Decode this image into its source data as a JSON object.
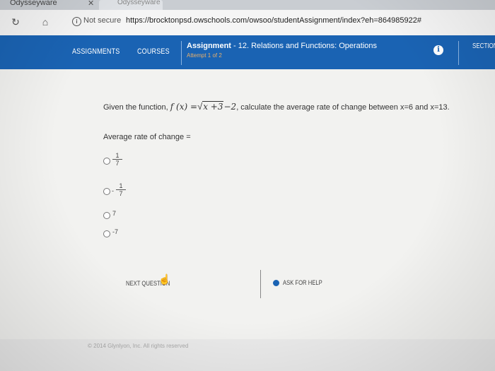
{
  "browser": {
    "tab_title": "Odysseyware",
    "tab_close": "✕",
    "tab2_title": "Odysseyware",
    "security_label": "Not secure",
    "url": "https://brocktonpsd.owschools.com/owsoo/studentAssignment/index?eh=864985922#"
  },
  "nav": {
    "assignments": "ASSIGNMENTS",
    "courses": "COURSES",
    "assignment_label": "Assignment",
    "assignment_title": "- 12. Relations and Functions: Operations",
    "attempt": "Attempt 1 of 2",
    "section": "SECTION"
  },
  "question": {
    "prefix": "Given the function,",
    "fx": "f (x) =",
    "radicand": "x +3",
    "suffix_expr": "−2",
    "suffix_text": ", calculate the average rate of change between x=6 and x=13.",
    "prompt": "Average rate of change ="
  },
  "options": [
    {
      "sign": "",
      "num": "1",
      "den": "7"
    },
    {
      "sign": "-",
      "num": "1",
      "den": "7"
    },
    {
      "text": "7"
    },
    {
      "text": "-7"
    }
  ],
  "actions": {
    "next": "NEXT QUESTION",
    "help": "ASK FOR HELP"
  },
  "footer": {
    "copyright": "© 2014 Glynlyon, Inc. All rights reserved"
  },
  "colors": {
    "accent": "#1a63b3",
    "attempt": "#e9b06a"
  }
}
